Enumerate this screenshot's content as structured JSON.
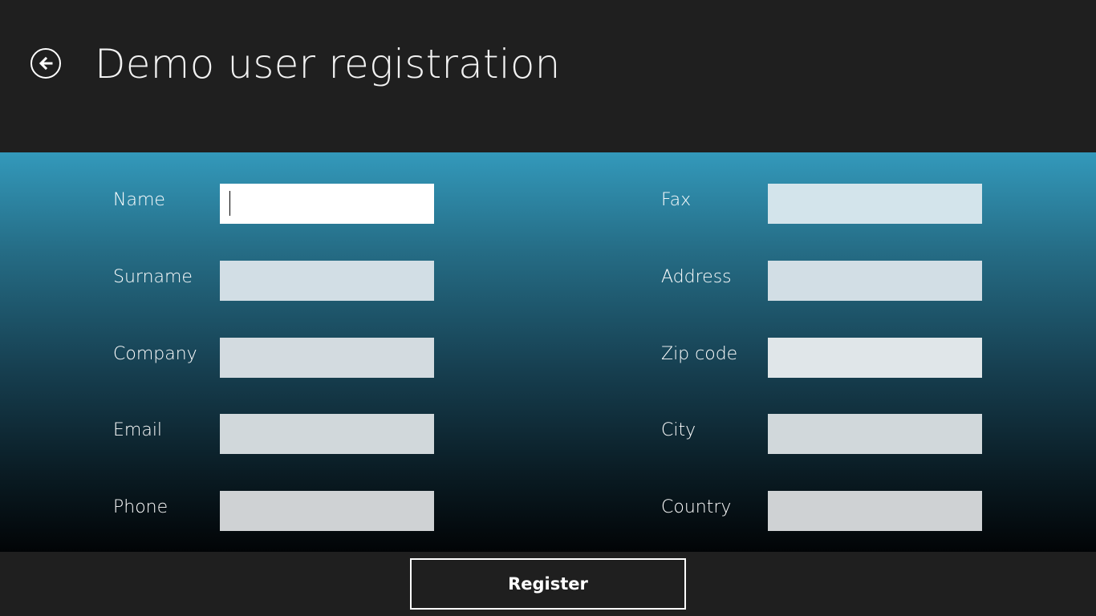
{
  "header": {
    "title": "Demo user registration",
    "back_icon": "back-arrow-circle-icon"
  },
  "form": {
    "left": [
      {
        "label": "Name",
        "value": "",
        "focused": true
      },
      {
        "label": "Surname",
        "value": ""
      },
      {
        "label": "Company",
        "value": ""
      },
      {
        "label": "Email",
        "value": ""
      },
      {
        "label": "Phone",
        "value": ""
      }
    ],
    "right": [
      {
        "label": "Fax",
        "value": ""
      },
      {
        "label": "Address",
        "value": ""
      },
      {
        "label": "Zip code",
        "value": ""
      },
      {
        "label": "City",
        "value": ""
      },
      {
        "label": "Country",
        "value": ""
      }
    ]
  },
  "footer": {
    "register_label": "Register"
  },
  "colors": {
    "background": "#1f1f1f",
    "panel_top": "#3399bb",
    "panel_bottom": "#020406",
    "input_focused": "#ffffff",
    "input_idle": "#d2dde3"
  }
}
